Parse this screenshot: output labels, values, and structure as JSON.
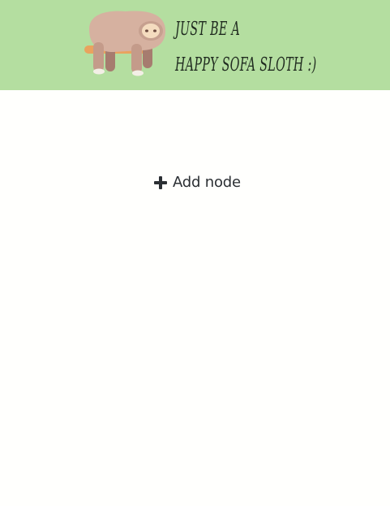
{
  "banner": {
    "bg_color": "#b4dea0",
    "mascot_icon": "sloth-on-sofa-illustration",
    "tagline_line1": "JUST BE A",
    "tagline_line2": "HAPPY SOFA SLOTH :)"
  },
  "main": {
    "add_node": {
      "icon": "plus-icon",
      "label": "Add node"
    }
  }
}
